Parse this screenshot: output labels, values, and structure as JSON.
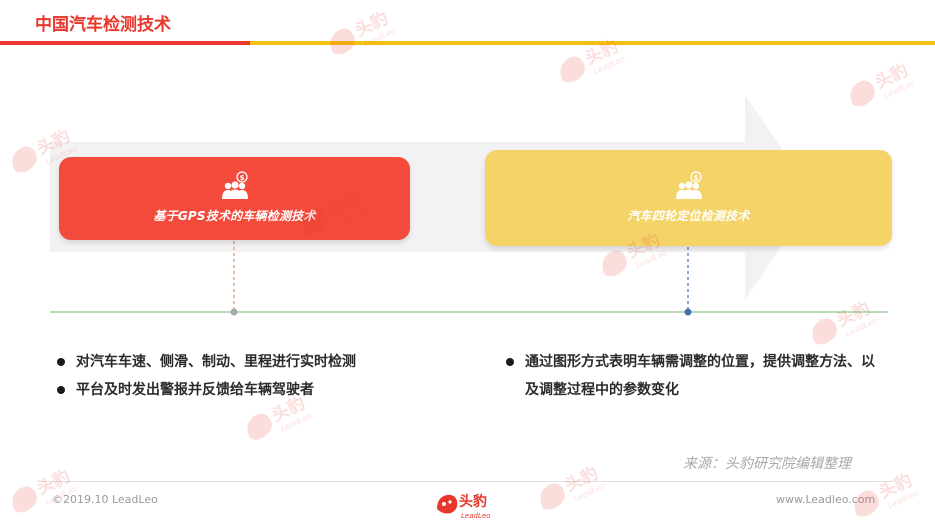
{
  "header": {
    "title": "中国汽车检测技术"
  },
  "cards": [
    {
      "label": "基于GPS技术的车辆检测技术",
      "icon": "people-money-icon"
    },
    {
      "label": "汽车四轮定位检测技术",
      "icon": "people-money-icon"
    }
  ],
  "bullets_left": [
    "对汽车车速、侧滑、制动、里程进行实时检测",
    "平台及时发出警报并反馈给车辆驾驶者"
  ],
  "bullets_right": [
    "通过图形方式表明车辆需调整的位置，提供调整方法、以及调整过程中的参数变化"
  ],
  "source": "来源：头豹研究院编辑整理",
  "footer": {
    "copyright": "©2019.10 LeadLeo",
    "url": "www.Leadleo.com",
    "logo_text": "头豹",
    "logo_sub": "LeadLeo"
  },
  "watermark": {
    "text": "头豹",
    "sub": "LeadLeo"
  },
  "colors": {
    "accent_red": "#e8382d",
    "accent_yellow": "#f5c016",
    "card_left": "#f34a3c",
    "card_right": "#f4d468"
  }
}
